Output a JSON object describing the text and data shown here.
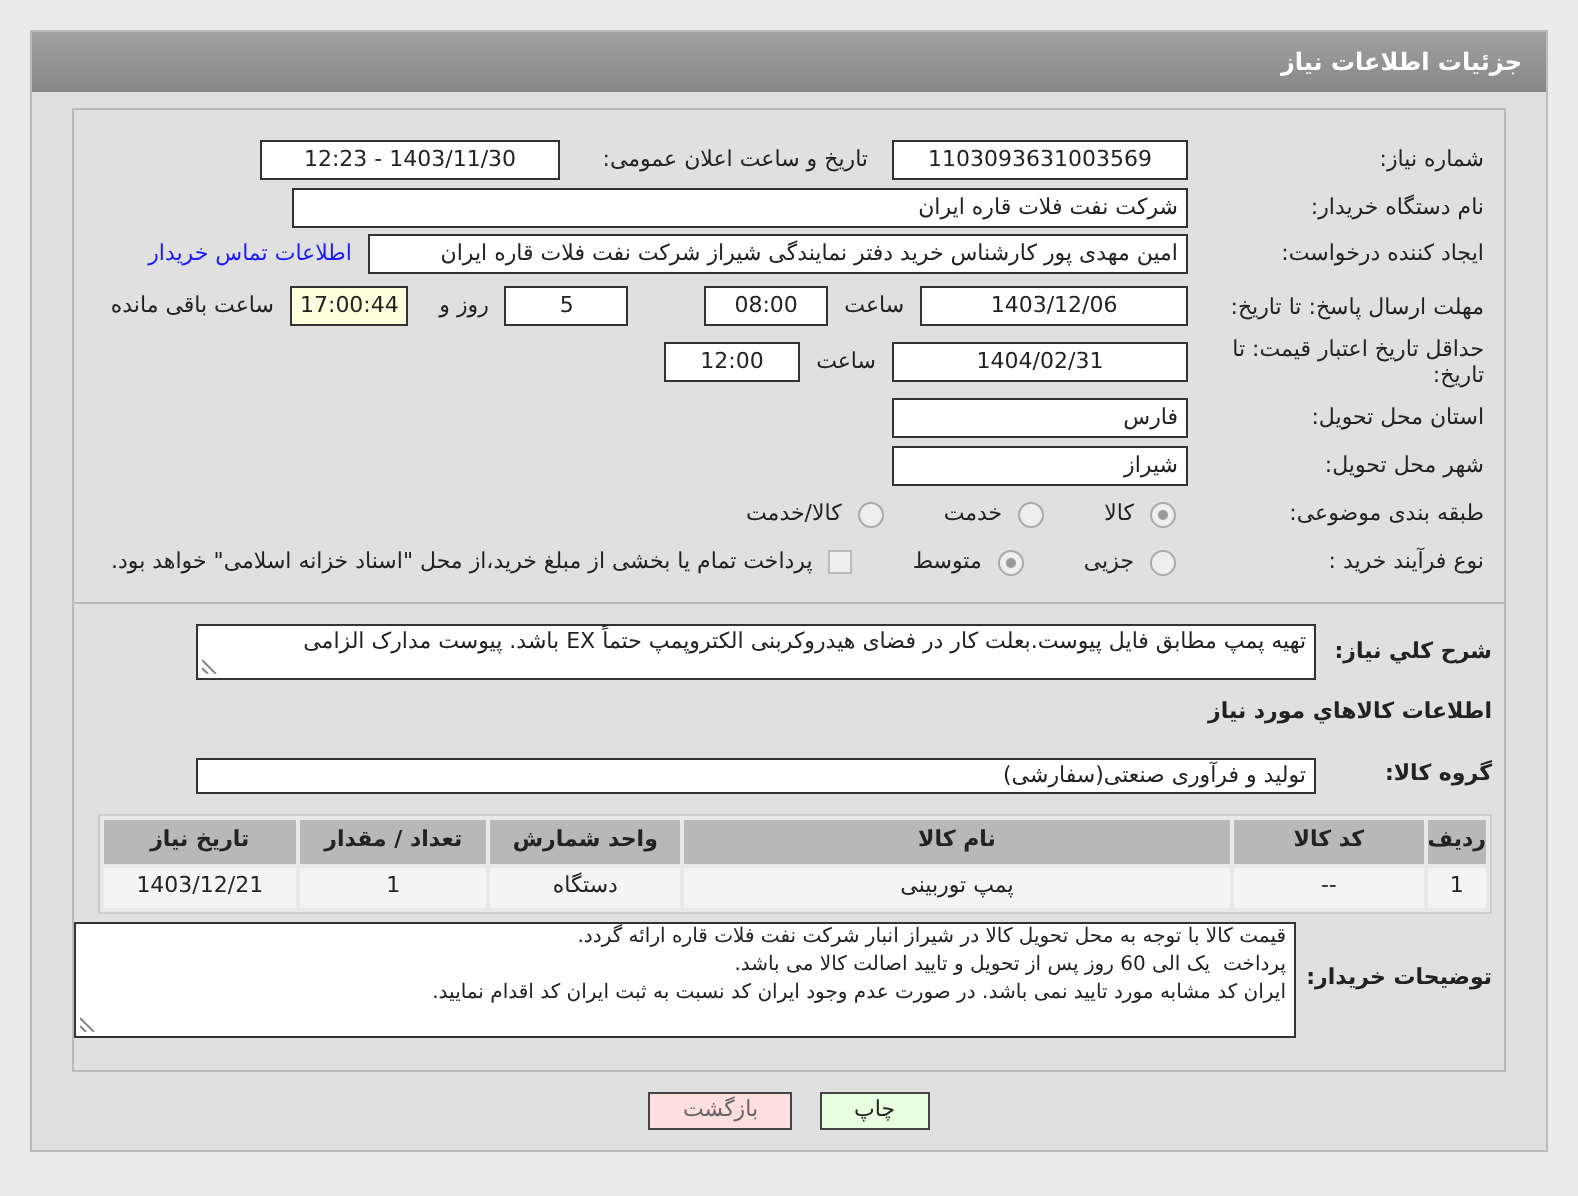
{
  "header": {
    "title": "جزئیات اطلاعات نیاز"
  },
  "need_number": {
    "label": "شماره نیاز:",
    "value": "1103093631003569"
  },
  "announce": {
    "label": "تاریخ و ساعت اعلان عمومی:",
    "value": "1403/11/30 - 12:23"
  },
  "buyer_org": {
    "label": "نام دستگاه خریدار:",
    "value": "شرکت نفت فلات قاره ایران"
  },
  "requester": {
    "label": "ایجاد کننده درخواست:",
    "value": "امین مهدی پور کارشناس خرید دفتر نمایندگی شیراز شرکت نفت فلات قاره ایران",
    "link": "اطلاعات تماس خریدار"
  },
  "response_deadline": {
    "label": "مهلت ارسال پاسخ: تا تاریخ:",
    "date": "1403/12/06",
    "time_label": "ساعت",
    "time": "08:00",
    "days": "5",
    "days_label": "روز و",
    "remaining": "17:00:44",
    "remaining_label": "ساعت باقی مانده"
  },
  "price_validity": {
    "label": "حداقل تاریخ اعتبار قیمت: تا تاریخ:",
    "date": "1404/02/31",
    "time_label": "ساعت",
    "time": "12:00"
  },
  "province": {
    "label": "استان محل تحویل:",
    "value": "فارس"
  },
  "city": {
    "label": "شهر محل تحویل:",
    "value": "شیراز"
  },
  "category": {
    "label": "طبقه بندی موضوعی:",
    "options": [
      {
        "label": "کالا",
        "selected": true
      },
      {
        "label": "خدمت",
        "selected": false
      },
      {
        "label": "کالا/خدمت",
        "selected": false
      }
    ]
  },
  "purchase_type": {
    "label": "نوع فرآیند خرید :",
    "options": [
      {
        "label": "جزیی",
        "selected": false
      },
      {
        "label": "متوسط",
        "selected": true
      }
    ],
    "checkbox": {
      "label": "پرداخت تمام یا بخشی از مبلغ خرید،از محل \"اسناد خزانه اسلامی\" خواهد بود.",
      "checked": false
    }
  },
  "description": {
    "label": "شرح کلي نياز:",
    "value": "تهیه پمپ مطابق فایل پیوست.بعلت کار در فضای هیدروکربنی الکتروپمپ حتماً EX باشد. پیوست مدارک الزامی"
  },
  "goods_section_title": "اطلاعات کالاهاي مورد نياز",
  "goods_group": {
    "label": "گروه کالا:",
    "value": "تولید و فرآوری صنعتی(سفارشی)"
  },
  "table": {
    "columns": [
      "ردیف",
      "کد کالا",
      "نام کالا",
      "واحد شمارش",
      "تعداد / مقدار",
      "تاریخ نیاز"
    ],
    "rows": [
      [
        "1",
        "--",
        "پمپ توربینی",
        "دستگاه",
        "1",
        "1403/12/21"
      ]
    ]
  },
  "buyer_notes": {
    "label": "توضیحات خریدار:",
    "value": "قیمت کالا با توجه به محل تحویل کالا در شیراز انبار شرکت نفت فلات قاره ارائه گردد.\nپرداخت  یک الی 60 روز پس از تحویل و تایید اصالت کالا می باشد.\nایران کد مشابه مورد تایید نمی باشد. در صورت عدم وجود ایران کد نسبت به ثبت ایران کد اقدام نمایید."
  },
  "buttons": [
    {
      "label": "چاپ",
      "kind": "print"
    },
    {
      "label": "بازگشت",
      "kind": "back"
    }
  ]
}
